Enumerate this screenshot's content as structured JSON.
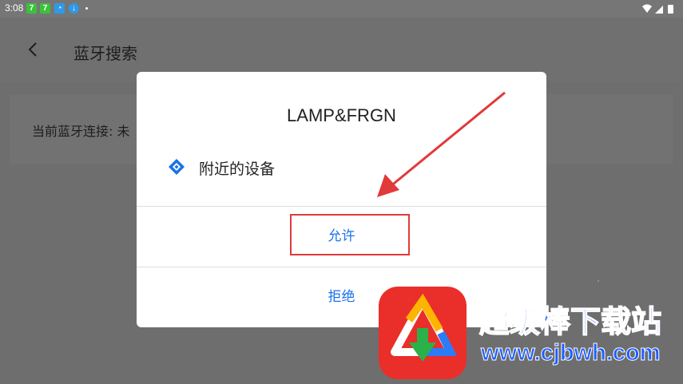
{
  "status_bar": {
    "time": "3:08",
    "notifications": [
      {
        "icon": "app-7-icon",
        "glyph": "7",
        "color": "#3cc13b"
      },
      {
        "icon": "app-7-icon",
        "glyph": "7",
        "color": "#3cc13b"
      },
      {
        "icon": "app-chat-icon",
        "glyph": "◔",
        "color": "#2f9ae6"
      },
      {
        "icon": "download-icon",
        "glyph": "↓",
        "color": "#2f9ae6"
      }
    ],
    "system_icons": [
      "wifi-icon",
      "signal-icon",
      "battery-icon"
    ]
  },
  "app_bar": {
    "back_icon": "back-arrow-icon",
    "title": "蓝牙搜索"
  },
  "background_card": {
    "label": "当前蓝牙连接: 未"
  },
  "dialog": {
    "title": "LAMP&FRGN",
    "permission_icon": "nearby-devices-icon",
    "permission_label": "附近的设备",
    "allow_label": "允许",
    "deny_label": "拒绝"
  },
  "colors": {
    "accent": "#1a73e8",
    "annotation": "#e03a3a"
  },
  "watermark": {
    "name": "超级棒下载站",
    "url": "www.cjbwh.com",
    "logo_icon": "download-site-logo-icon"
  }
}
